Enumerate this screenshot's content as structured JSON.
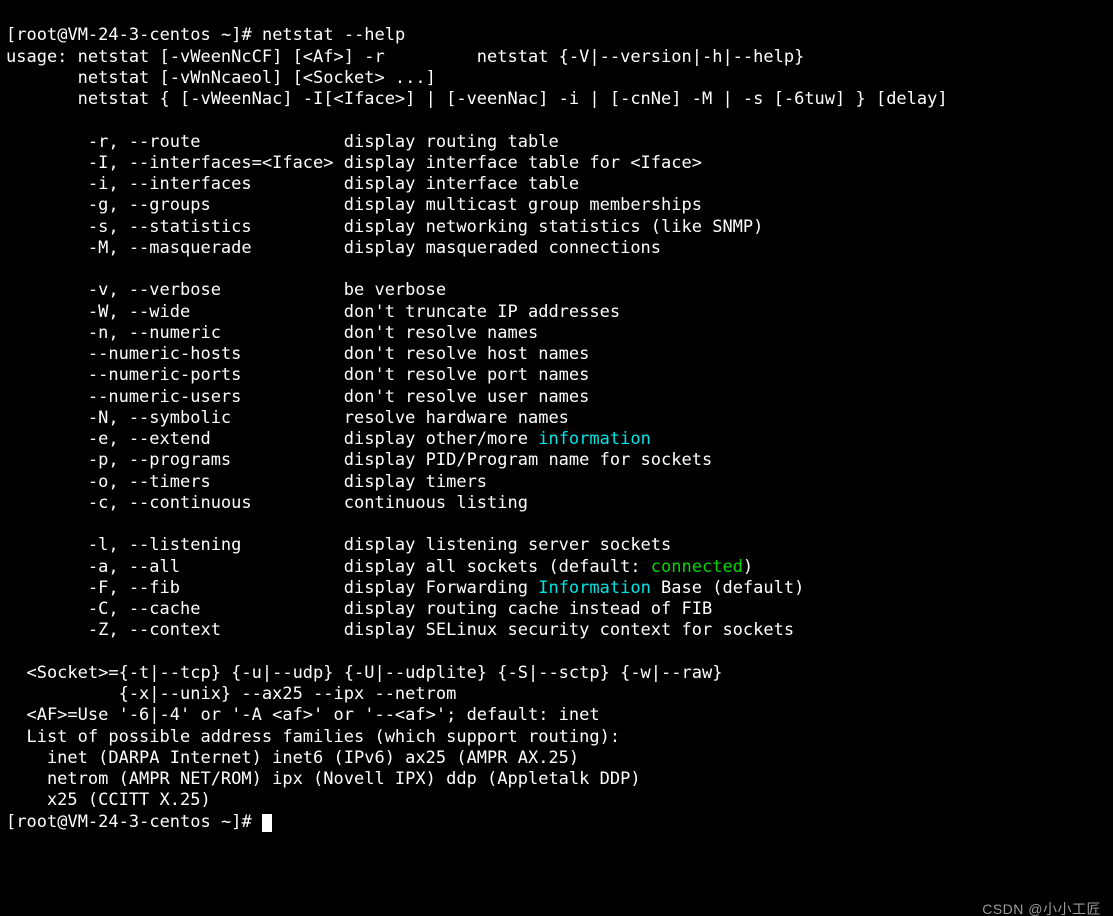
{
  "prompt1": {
    "user": "root",
    "open": "[",
    "at": "@",
    "host": "VM-24-3-centos",
    "cwd": " ~",
    "close": "]# ",
    "cmd": "netstat --help"
  },
  "usage": {
    "l1a": "usage: netstat [-vWeenNcCF] [<Af>] -r         netstat {-V|--version|-h|--help}",
    "l2": "       netstat [-vWnNcaeol] [<Socket> ...]",
    "l3": "       netstat { [-vWeenNac] -I[<Iface>] | [-veenNac] -i | [-cnNe] -M | -s [-6tuw] } [delay]"
  },
  "opts1": {
    "r": "        -r, --route              display routing table",
    "I": "        -I, --interfaces=<Iface> display interface table for <Iface>",
    "i": "        -i, --interfaces         display interface table",
    "g": "        -g, --groups             display multicast group memberships",
    "s": "        -s, --statistics         display networking statistics (like SNMP)",
    "M": "        -M, --masquerade         display masqueraded connections"
  },
  "opts2": {
    "v": "        -v, --verbose            be verbose",
    "W": "        -W, --wide               don't truncate IP addresses",
    "n": "        -n, --numeric            don't resolve names",
    "nh": "        --numeric-hosts          don't resolve host names",
    "np": "        --numeric-ports          don't resolve port names",
    "nu": "        --numeric-users          don't resolve user names",
    "N": "        -N, --symbolic           resolve hardware names",
    "e_pre": "        -e, --extend             display other/more ",
    "e_hi": "information",
    "p": "        -p, --programs           display PID/Program name for sockets",
    "o": "        -o, --timers             display timers",
    "c": "        -c, --continuous         continuous listing"
  },
  "opts3": {
    "l": "        -l, --listening          display listening server sockets",
    "a_pre": "        -a, --all                display all sockets (default: ",
    "a_hi": "connected",
    "a_post": ")",
    "F_pre": "        -F, --fib                display Forwarding ",
    "F_hi": "Information",
    "F_post": " Base (default)",
    "C": "        -C, --cache              display routing cache instead of FIB",
    "Z": "        -Z, --context            display SELinux security context for sockets"
  },
  "footer": {
    "sock1": "  <Socket>={-t|--tcp} {-u|--udp} {-U|--udplite} {-S|--sctp} {-w|--raw}",
    "sock2": "           {-x|--unix} --ax25 --ipx --netrom",
    "af": "  <AF>=Use '-6|-4' or '-A <af>' or '--<af>'; default: inet",
    "fam0": "  List of possible address families (which support routing):",
    "fam1": "    inet (DARPA Internet) inet6 (IPv6) ax25 (AMPR AX.25)",
    "fam2": "    netrom (AMPR NET/ROM) ipx (Novell IPX) ddp (Appletalk DDP)",
    "fam3": "    x25 (CCITT X.25)"
  },
  "prompt2": {
    "user": "root",
    "open": "[",
    "at": "@",
    "host": "VM-24-3-centos",
    "cwd": " ~",
    "close": "]# "
  },
  "watermark": "CSDN @小小工匠"
}
